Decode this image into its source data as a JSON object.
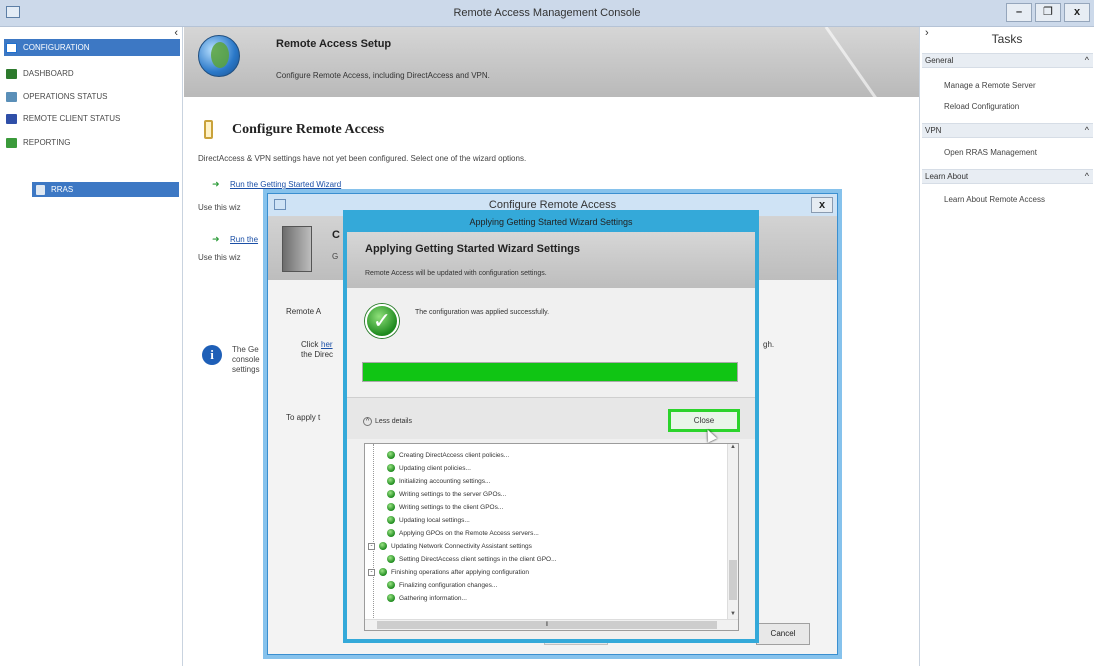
{
  "window": {
    "title": "Remote Access Management Console",
    "buttons": [
      "–",
      "❐",
      "x"
    ]
  },
  "nav": {
    "items": [
      {
        "label": "CONFIGURATION",
        "color": "#1e6fcf"
      },
      {
        "label": "DASHBOARD",
        "color": "#2d7a2d"
      },
      {
        "label": "OPERATIONS STATUS",
        "color": "#5a8fb8"
      },
      {
        "label": "REMOTE CLIENT STATUS",
        "color": "#2f4fa8"
      },
      {
        "label": "REPORTING",
        "color": "#3a9a3a"
      }
    ],
    "rras": "RRAS"
  },
  "banner": {
    "title": "Remote Access Setup",
    "subtitle": "Configure Remote Access, including DirectAccess and VPN."
  },
  "content": {
    "heading": "Configure Remote Access",
    "note": "DirectAccess & VPN settings have not yet been configured. Select one of the wizard options.",
    "link1": "Run the Getting Started Wizard",
    "desc1": "Use this wiz",
    "link2": "Run the",
    "desc2": "Use this wiz",
    "info_text": [
      "The Ge",
      "console",
      "settings"
    ]
  },
  "tasks": {
    "title": "Tasks",
    "sections": [
      {
        "label": "General",
        "items": [
          "Manage a Remote Server",
          "Reload Configuration"
        ]
      },
      {
        "label": "VPN",
        "items": [
          "Open RRAS Management"
        ]
      },
      {
        "label": "Learn About",
        "items": [
          "Learn About Remote Access"
        ]
      }
    ]
  },
  "dialog_configure": {
    "title": "Configure Remote Access",
    "close": "x",
    "header_title": "C",
    "header_sub": "G",
    "text_remote": "Remote A",
    "text_click": "Click",
    "text_here": "her",
    "text_direc": "the Direc",
    "text_suffix": "gh.",
    "text_apply": "To apply t",
    "cancel": "Cancel"
  },
  "dialog_apply": {
    "title": "Applying Getting Started Wizard Settings",
    "header_title": "Applying Getting Started Wizard Settings",
    "header_sub": "Remote Access will be updated with configuration settings.",
    "success": "The configuration was applied successfully.",
    "progress": 1.0,
    "less_details": "Less details",
    "close_button": "Close",
    "log": [
      {
        "text": "Creating DirectAccess client policies...",
        "level": 2
      },
      {
        "text": "Updating client policies...",
        "level": 2
      },
      {
        "text": "Initializing accounting settings...",
        "level": 2
      },
      {
        "text": "Writing settings to the server GPOs...",
        "level": 2
      },
      {
        "text": "Writing settings to the client GPOs...",
        "level": 2
      },
      {
        "text": "Updating local settings...",
        "level": 2
      },
      {
        "text": "Applying GPOs on the Remote Access servers...",
        "level": 2
      },
      {
        "text": "Updating Network Connectivity Assistant settings",
        "level": 1,
        "expander": "-"
      },
      {
        "text": "Setting DirectAccess client settings in the client GPO...",
        "level": 2
      },
      {
        "text": "Finishing operations after applying configuration",
        "level": 1,
        "expander": "-"
      },
      {
        "text": "Finalizing configuration changes...",
        "level": 2
      },
      {
        "text": "Gathering information...",
        "level": 2
      }
    ]
  }
}
